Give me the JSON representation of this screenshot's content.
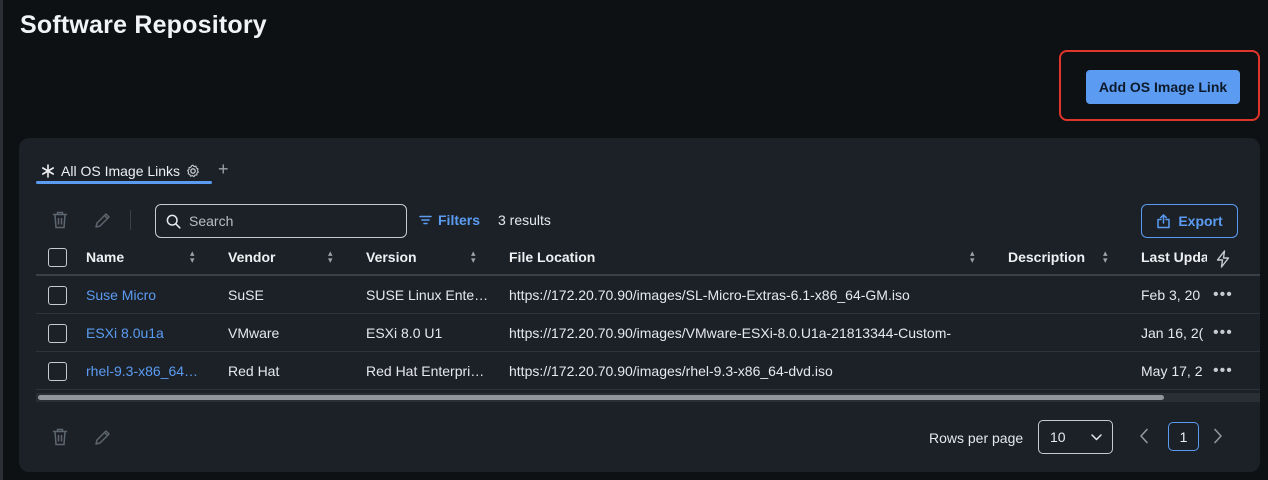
{
  "page": {
    "title": "Software Repository"
  },
  "header": {
    "add_button_label": "Add OS Image Link"
  },
  "tabs": {
    "active_label": "All OS Image Links"
  },
  "toolbar": {
    "search_placeholder": "Search",
    "filters_label": "Filters",
    "results_text": "3 results",
    "export_label": "Export"
  },
  "table": {
    "columns": [
      "Name",
      "Vendor",
      "Version",
      "File Location",
      "Description",
      "Last Upda"
    ],
    "rows": [
      {
        "name": "Suse Micro",
        "vendor": "SuSE",
        "version": "SUSE Linux Ente…",
        "file_location": "https://172.20.70.90/images/SL-Micro-Extras-6.1-x86_64-GM.iso",
        "description": "",
        "last_updated": "Feb 3, 20"
      },
      {
        "name": "ESXi 8.0u1a",
        "vendor": "VMware",
        "version": "ESXi 8.0 U1",
        "file_location": "https://172.20.70.90/images/VMware-ESXi-8.0.U1a-21813344-Custom-",
        "description": "",
        "last_updated": "Jan 16, 2("
      },
      {
        "name": "rhel-9.3-x86_64…",
        "vendor": "Red Hat",
        "version": "Red Hat Enterpri…",
        "file_location": "https://172.20.70.90/images/rhel-9.3-x86_64-dvd.iso",
        "description": "",
        "last_updated": "May 17, 2"
      }
    ]
  },
  "pagination": {
    "rows_per_page_label": "Rows per page",
    "rows_per_page_value": "10",
    "current_page": "1"
  },
  "colors": {
    "accent": "#5b9cf2",
    "highlight": "#e0352b",
    "background": "#0e1114",
    "card": "#1c2128"
  }
}
